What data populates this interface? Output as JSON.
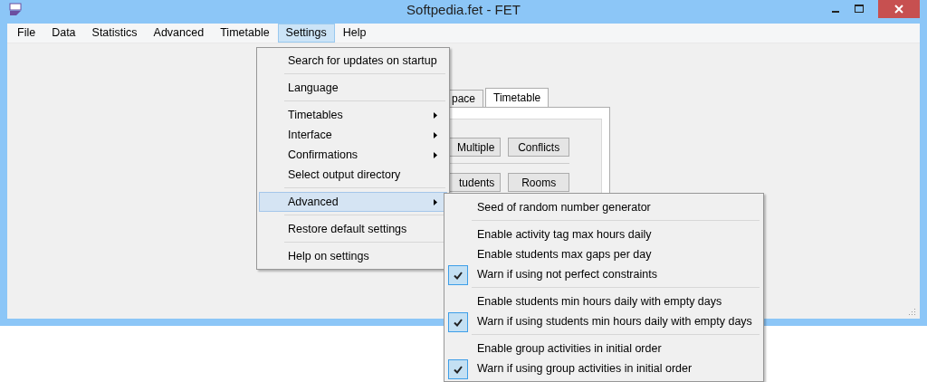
{
  "window": {
    "title": "Softpedia.fet - FET"
  },
  "menu_bar": [
    {
      "label": "File",
      "selected": false
    },
    {
      "label": "Data",
      "selected": false
    },
    {
      "label": "Statistics",
      "selected": false
    },
    {
      "label": "Advanced",
      "selected": false
    },
    {
      "label": "Timetable",
      "selected": false
    },
    {
      "label": "Settings",
      "selected": true
    },
    {
      "label": "Help",
      "selected": false
    }
  ],
  "tabs": [
    {
      "label": "pace",
      "selected": false
    },
    {
      "label": "Timetable",
      "selected": true
    }
  ],
  "tab_buttons": [
    [
      "Multiple",
      "Conflicts"
    ],
    [
      "tudents",
      "Rooms"
    ]
  ],
  "settings_menu": [
    [
      {
        "label": "Search for updates on startup",
        "submenu": false,
        "selected": false
      }
    ],
    [
      {
        "label": "Language",
        "submenu": false,
        "selected": false
      }
    ],
    [
      {
        "label": "Timetables",
        "submenu": true,
        "selected": false
      },
      {
        "label": "Interface",
        "submenu": true,
        "selected": false
      },
      {
        "label": "Confirmations",
        "submenu": true,
        "selected": false
      },
      {
        "label": "Select output directory",
        "submenu": false,
        "selected": false
      }
    ],
    [
      {
        "label": "Advanced",
        "submenu": true,
        "selected": true
      }
    ],
    [
      {
        "label": "Restore default settings",
        "submenu": false,
        "selected": false
      }
    ],
    [
      {
        "label": "Help on settings",
        "submenu": false,
        "selected": false
      }
    ]
  ],
  "advanced_submenu": [
    [
      {
        "label": "Seed of random number generator",
        "checked": false
      }
    ],
    [
      {
        "label": "Enable activity tag max hours daily",
        "checked": false
      },
      {
        "label": "Enable students max gaps per day",
        "checked": false
      },
      {
        "label": "Warn if using not perfect constraints",
        "checked": true
      }
    ],
    [
      {
        "label": "Enable students min hours daily with empty days",
        "checked": false
      },
      {
        "label": "Warn if using students min hours daily with empty days",
        "checked": true
      }
    ],
    [
      {
        "label": "Enable group activities in initial order",
        "checked": false
      },
      {
        "label": "Warn if using group activities in initial order",
        "checked": true
      }
    ]
  ]
}
